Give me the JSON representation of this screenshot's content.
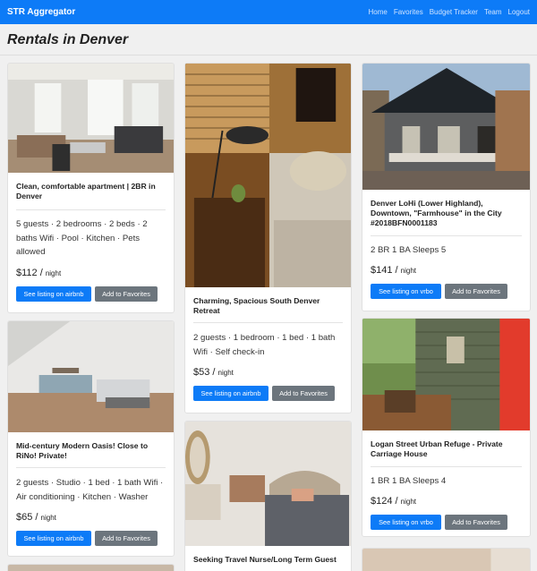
{
  "nav": {
    "brand": "STR Aggregator",
    "links": [
      "Home",
      "Favorites",
      "Budget Tracker",
      "Team",
      "Logout"
    ]
  },
  "page": {
    "title": "Rentals in Denver"
  },
  "listings": [
    {
      "title": "Clean, comfortable apartment | 2BR in Denver",
      "amenities": "5 guests · 2 bedrooms · 2 beds · 2 baths Wifi · Pool · Kitchen · Pets allowed",
      "price": "$112",
      "per": "night",
      "primary_button": "See listing on airbnb",
      "fav_button": "Add to Favorites"
    },
    {
      "title": "Charming, Spacious South Denver Retreat",
      "amenities": "2 guests · 1 bedroom · 1 bed · 1 bath Wifi · Self check-in",
      "price": "$53",
      "per": "night",
      "primary_button": "See listing on airbnb",
      "fav_button": "Add to Favorites"
    },
    {
      "title": "Denver LoHi (Lower Highland), Downtown, \"Farmhouse\" in the City #2018BFN0001183",
      "amenities": "2 BR 1 BA Sleeps 5",
      "price": "$141",
      "per": "night",
      "primary_button": "See listing on vrbo",
      "fav_button": "Add to Favorites"
    },
    {
      "title": "Mid-century Modern Oasis! Close to RiNo! Private!",
      "amenities": "2 guests · Studio · 1 bed · 1 bath Wifi · Air conditioning · Kitchen · Washer",
      "price": "$65",
      "per": "night",
      "primary_button": "See listing on airbnb",
      "fav_button": "Add to Favorites"
    },
    {
      "title": "Logan Street Urban Refuge - Private Carriage House",
      "amenities": "1 BR 1 BA Sleeps 4",
      "price": "$124",
      "per": "night",
      "primary_button": "See listing on vrbo",
      "fav_button": "Add to Favorites"
    },
    {
      "title": "Seeking Travel Nurse/Long Term Guest"
    }
  ]
}
